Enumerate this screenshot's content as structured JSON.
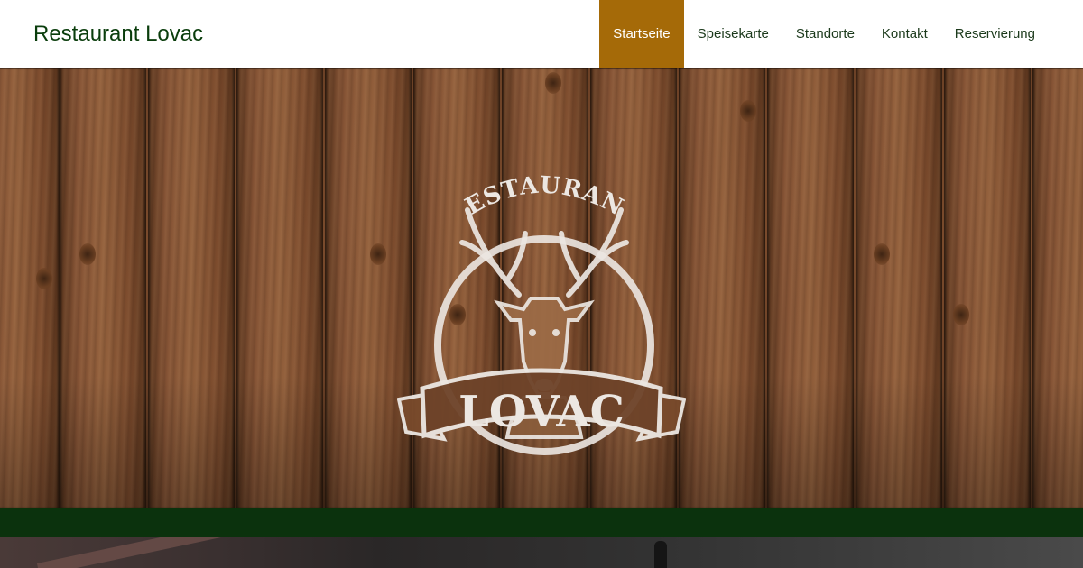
{
  "header": {
    "brand": "Restaurant Lovac",
    "nav": [
      {
        "label": "Startseite",
        "active": true
      },
      {
        "label": "Speisekarte",
        "active": false
      },
      {
        "label": "Standorte",
        "active": false
      },
      {
        "label": "Kontakt",
        "active": false
      },
      {
        "label": "Reservierung",
        "active": false
      }
    ]
  },
  "hero": {
    "logo": {
      "top_text": "RESTAURANT",
      "banner_text": "LOVAC",
      "emblem": "deer-head-icon"
    }
  },
  "colors": {
    "brand_green": "#0a3d0c",
    "nav_active": "#a56a08",
    "band_green": "#0b320d",
    "wood": "#7a4b2c"
  }
}
